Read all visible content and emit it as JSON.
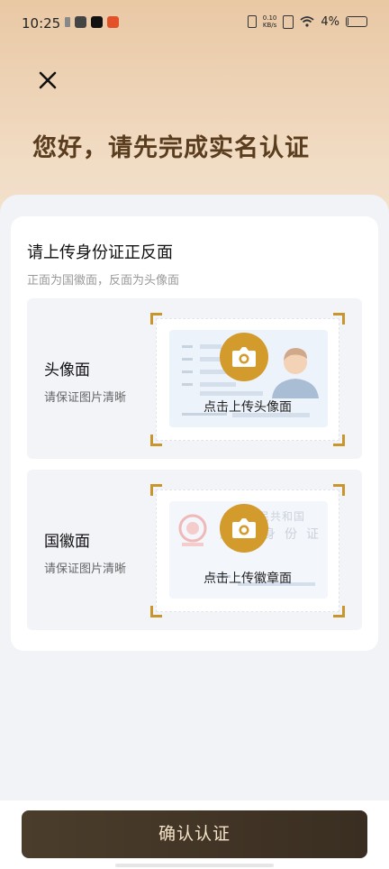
{
  "status_bar": {
    "time": "10:25",
    "net_speed_value": "0.10",
    "net_speed_unit": "KB/s",
    "battery": "4%",
    "battery_level": 0.04
  },
  "header": {
    "title": "您好，请先完成实名认证",
    "close_icon": "close-icon"
  },
  "card": {
    "title": "请上传身份证正反面",
    "subtitle": "正面为国徽面，反面为头像面",
    "portrait": {
      "label": "头像面",
      "hint": "请保证图片清晰",
      "upload_text": "点击上传头像面"
    },
    "emblem": {
      "label": "国徽面",
      "hint": "请保证图片清晰",
      "upload_text": "点击上传徽章面",
      "card_text_line1": "中华人民共和国",
      "card_text_line2": "居民身份证"
    }
  },
  "footer": {
    "confirm_label": "确认认证"
  },
  "colors": {
    "accent": "#d39a2c",
    "title": "#5a3d1e",
    "button": "#4a3a2a"
  }
}
